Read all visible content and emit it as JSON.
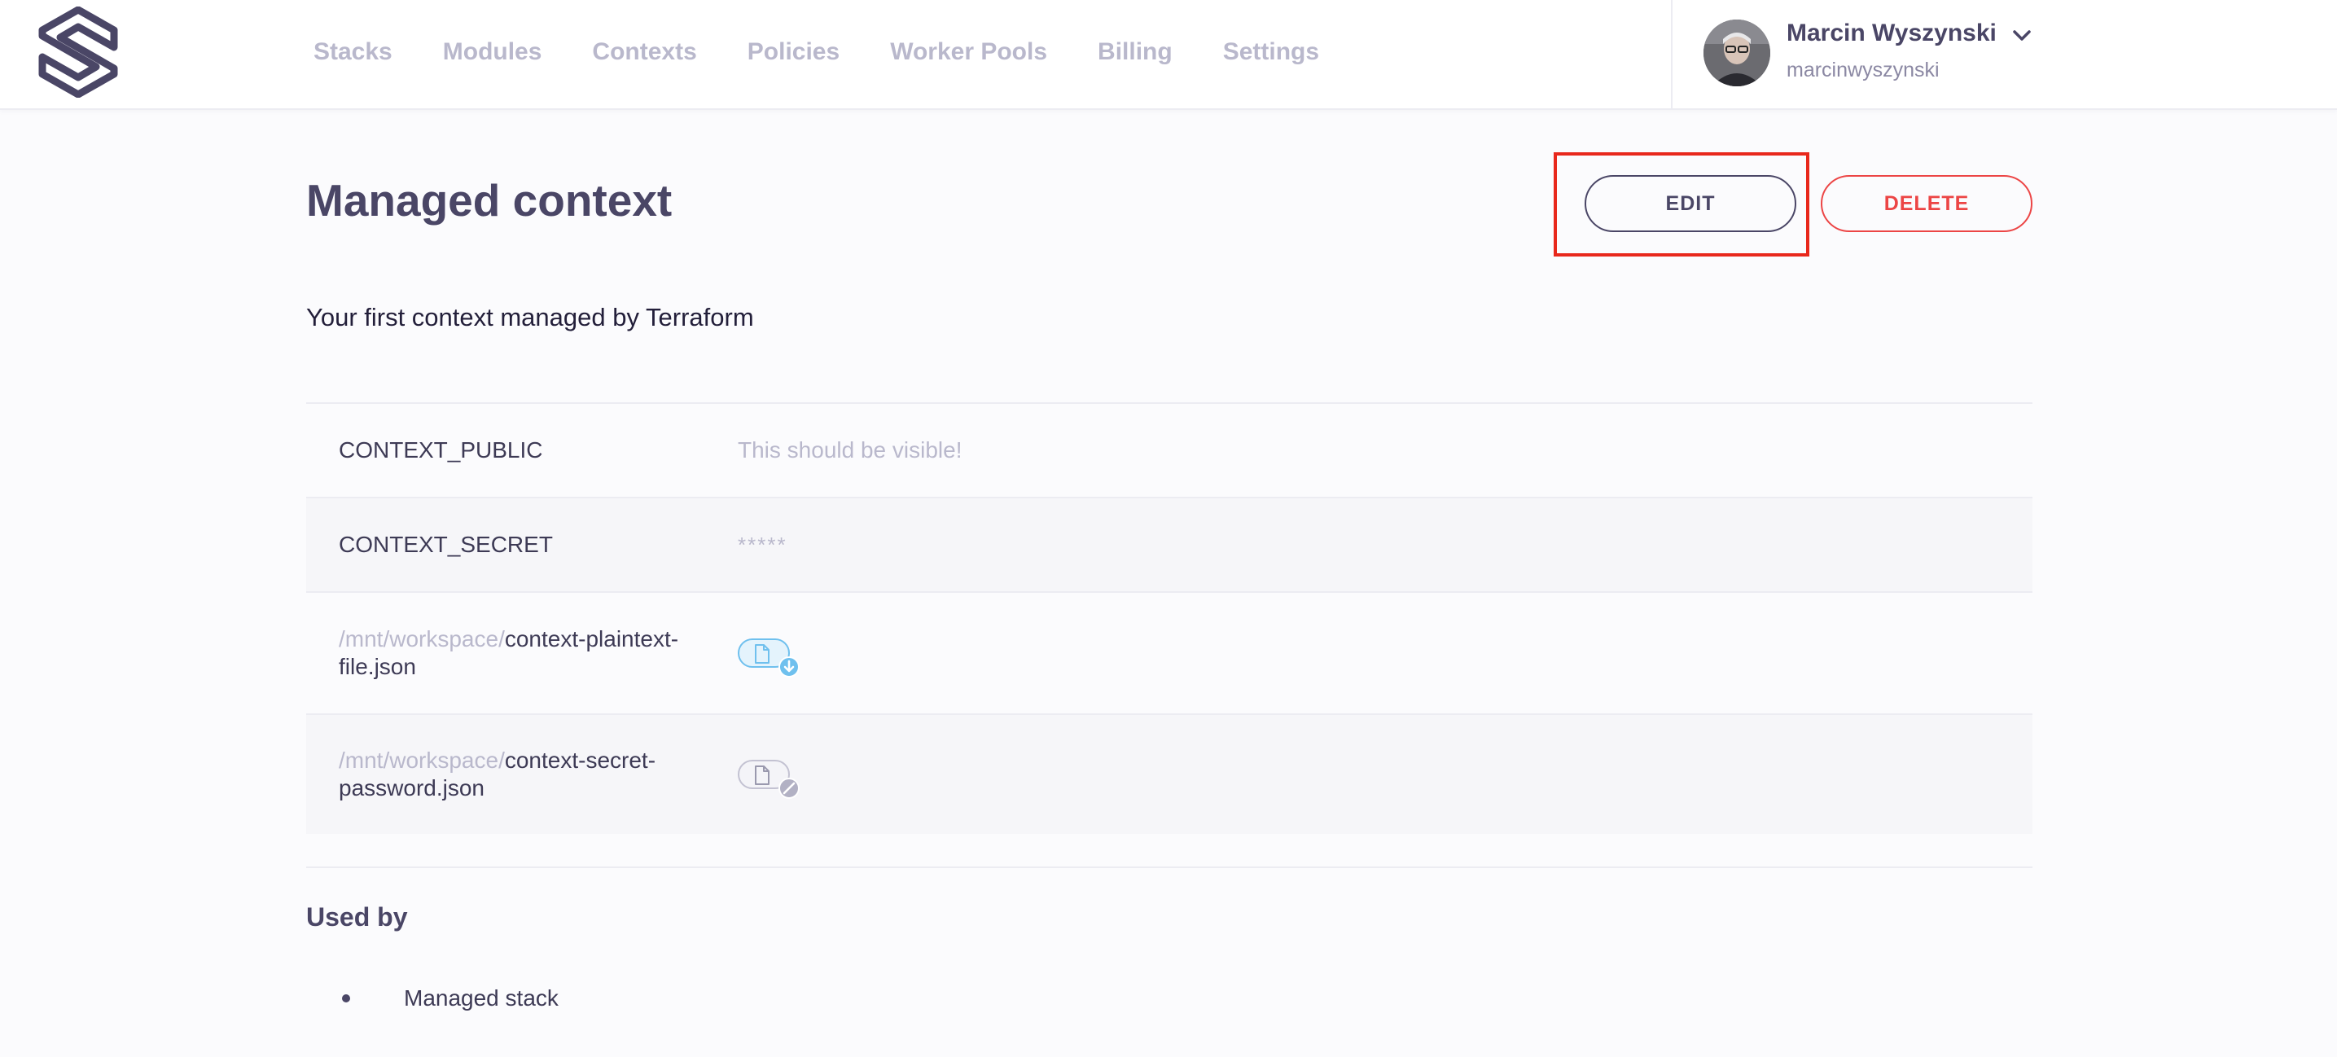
{
  "nav": {
    "logo_icon": "spacelift-logo",
    "items": [
      {
        "label": "Stacks"
      },
      {
        "label": "Modules"
      },
      {
        "label": "Contexts"
      },
      {
        "label": "Policies"
      },
      {
        "label": "Worker Pools"
      },
      {
        "label": "Billing"
      },
      {
        "label": "Settings"
      }
    ]
  },
  "profile": {
    "name": "Marcin Wyszynski",
    "handle": "marcinwyszynski",
    "dropdown_icon": "chevron-down-icon"
  },
  "page": {
    "title": "Managed context",
    "description": "Your first context managed by Terraform",
    "edit_label": "EDIT",
    "delete_label": "DELETE"
  },
  "variables": [
    {
      "key": "CONTEXT_PUBLIC",
      "value": "This should be visible!"
    },
    {
      "key": "CONTEXT_SECRET",
      "value": "*****"
    }
  ],
  "files": [
    {
      "prefix": "/mnt/workspace/",
      "name": "context-plaintext-file.json",
      "icon": "download-file-icon"
    },
    {
      "prefix": "/mnt/workspace/",
      "name": "context-secret-password.json",
      "icon": "secret-file-icon"
    }
  ],
  "used_by": {
    "title": "Used by",
    "items": [
      {
        "label": "Managed stack"
      }
    ]
  },
  "colors": {
    "text_primary": "#4a4666",
    "nav_inactive": "#b9b8cc",
    "danger": "#ec4545",
    "highlight": "#e8281c",
    "file_public": "#6fc0ee",
    "file_secret": "#c3c2d2"
  }
}
